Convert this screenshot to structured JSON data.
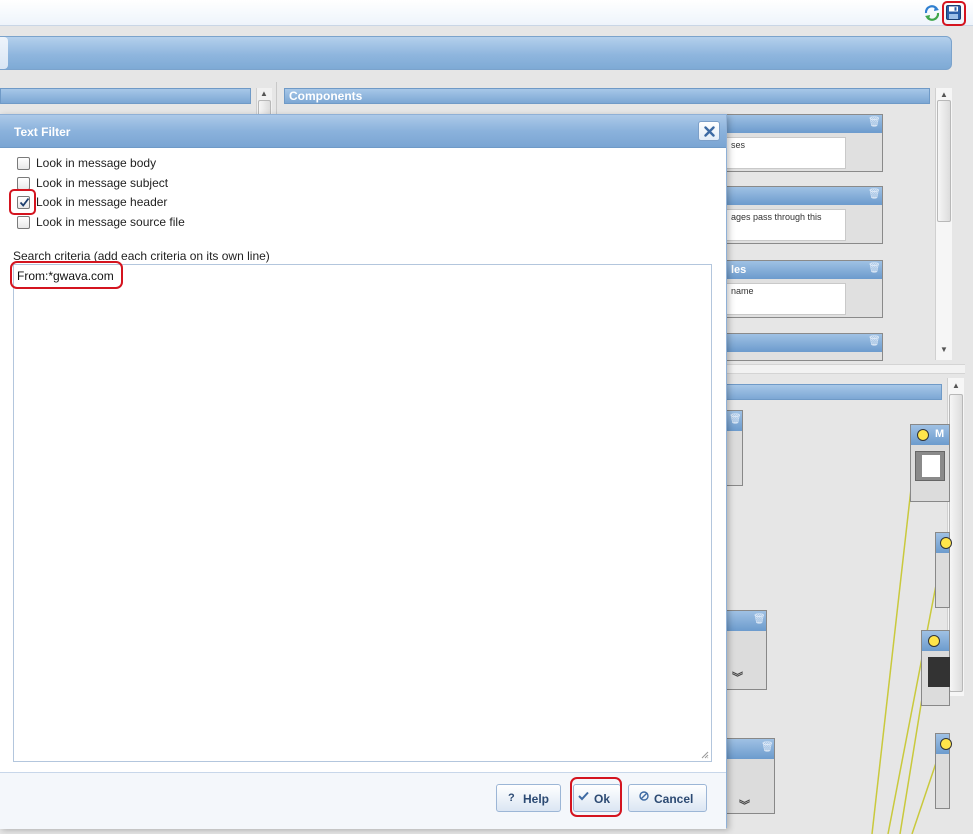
{
  "toolbar": {
    "refresh_icon": "refresh-icon",
    "save_icon": "save-disk-icon"
  },
  "panels": {
    "components_title": "Components"
  },
  "component_cards": [
    {
      "desc": "ses"
    },
    {
      "desc": "ages pass through this"
    },
    {
      "title": "les",
      "desc": "name"
    },
    {
      "desc": ""
    }
  ],
  "flow_nodes": {
    "node_title_partial": "M"
  },
  "dialog": {
    "title": "Text Filter",
    "options": [
      {
        "label": "Look in message body",
        "checked": false
      },
      {
        "label": "Look in message subject",
        "checked": false
      },
      {
        "label": "Look in message header",
        "checked": true
      },
      {
        "label": "Look in message source file",
        "checked": false
      }
    ],
    "criteria_label": "Search criteria (add each criteria on its own line)",
    "criteria_value": "From:*gwava.com",
    "buttons": {
      "help_label": "Help",
      "ok_label": "Ok",
      "cancel_label": "Cancel"
    }
  },
  "colors": {
    "accent": "#7ca7d4",
    "highlight_ring": "#d4141f",
    "button_text": "#2c4a73"
  }
}
